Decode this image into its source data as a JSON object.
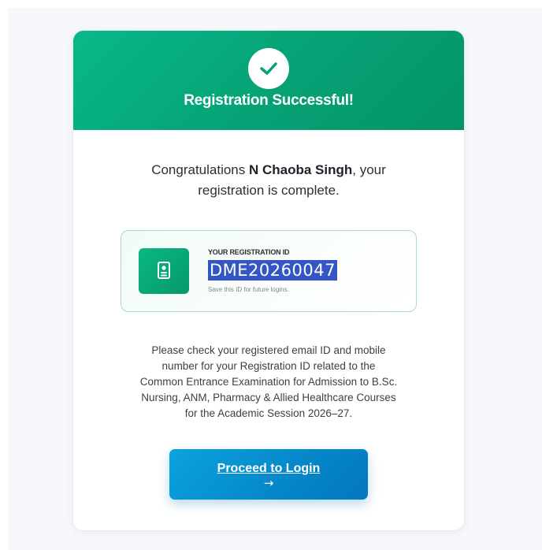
{
  "header": {
    "title": "Registration Successful!",
    "icon": "check-icon",
    "gradient_start": "#08b887",
    "gradient_end": "#049468"
  },
  "message": {
    "prefix": "Congratulations ",
    "name": "N Chaoba Singh",
    "suffix_line1": ", your",
    "line2": "registration is complete."
  },
  "registration": {
    "label": "YOUR REGISTRATION ID",
    "id": "DME20260047",
    "hint": "Save this ID for future logins.",
    "icon": "id-badge-icon"
  },
  "info": {
    "lines": [
      "Please check your registered email ID and mobile",
      "number for your Registration ID related to the",
      "Common Entrance Examination for Admission to B.Sc.",
      "Nursing, ANM, Pharmacy & Allied Healthcare Courses",
      "for the Academic Session 2026–27."
    ]
  },
  "actions": {
    "login_label": "Proceed to Login",
    "login_arrow": "→",
    "button_color": "#0587c9"
  }
}
